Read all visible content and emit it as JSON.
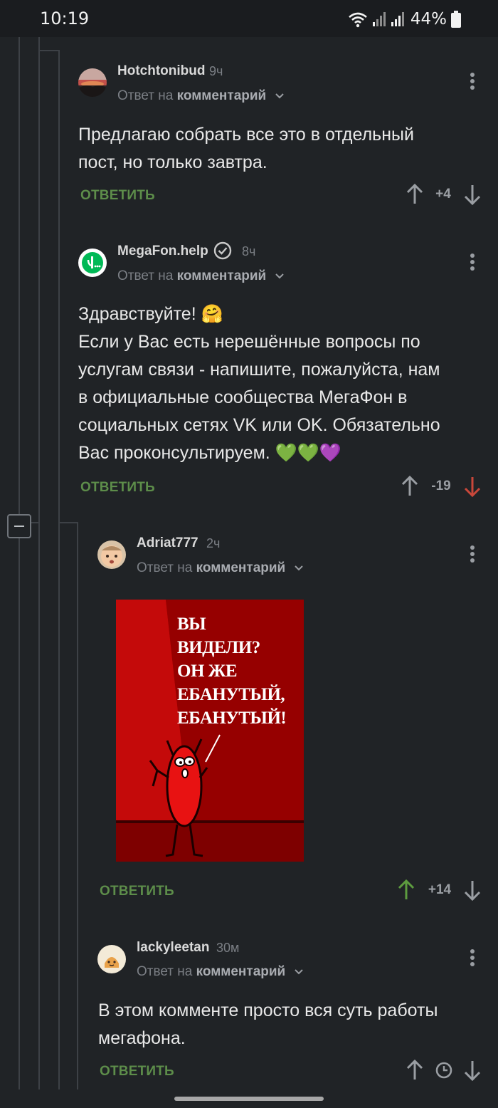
{
  "status_bar": {
    "time": "10:19",
    "battery": "44%"
  },
  "comments": [
    {
      "author": "Hotchtonibud",
      "age": "9ч",
      "reply_prefix": "Ответ на",
      "reply_target": "комментарий",
      "text_lines": [
        "Предлагаю собрать все это в отдельный",
        "пост, но только завтра."
      ],
      "reply_label": "ОТВЕТИТЬ",
      "rating": "+4"
    },
    {
      "author": "MegaFon.help",
      "age": "8ч",
      "verified": true,
      "reply_prefix": "Ответ на",
      "reply_target": "комментарий",
      "text_lines": [
        "Здравствуйте! 🤗",
        "Если у Вас есть нерешённые вопросы по",
        "услугам связи - напишите, пожалуйста, нам",
        "в официальные сообщества МегаФон в",
        "социальных сетях VK или OK. Обязательно",
        "Вас проконсультируем. 💚💚💜"
      ],
      "reply_label": "ОТВЕТИТЬ",
      "rating": "-19",
      "vote_state": "downvoted"
    },
    {
      "author": "Adriat777",
      "age": "2ч",
      "reply_prefix": "Ответ на",
      "reply_target": "комментарий",
      "image_text": "ВЫ\nВИДЕЛИ?\nОН ЖЕ\nЕБАНУТЫЙ,\nЕБАНУТЫЙ!",
      "reply_label": "ОТВЕТИТЬ",
      "rating": "+14",
      "vote_state": "upvoted"
    },
    {
      "author": "lackyleetan",
      "age": "30м",
      "reply_prefix": "Ответ на",
      "reply_target": "комментарий",
      "text_lines": [
        "В этом комменте просто вся суть работы",
        "мегафона."
      ],
      "reply_label": "ОТВЕТИТЬ",
      "rating_icon": "clock-icon"
    }
  ],
  "colors": {
    "background": "#202326",
    "reply": "#5d8d4a",
    "upvote": "#5d9c3f",
    "downvote": "#c9473a",
    "meme_red": "#9e0000"
  }
}
